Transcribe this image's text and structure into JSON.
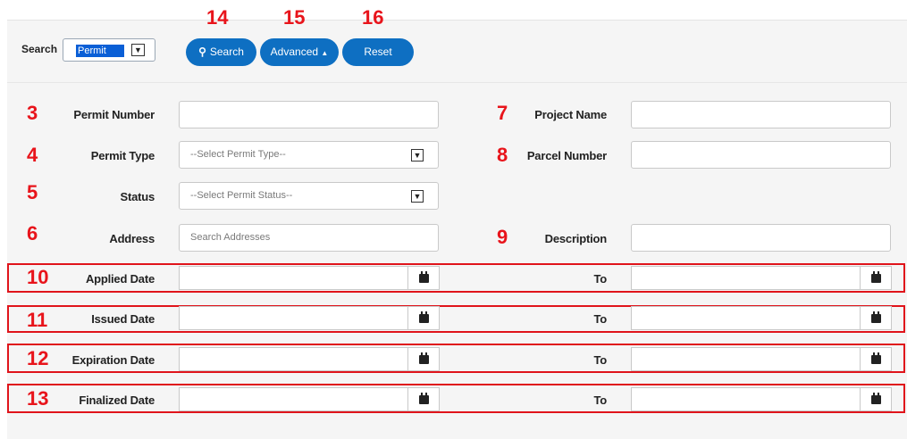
{
  "annotations": {
    "search_btn": "14",
    "advanced_btn": "15",
    "reset_btn": "16",
    "permit_number": "3",
    "permit_type": "4",
    "status": "5",
    "address": "6",
    "project_name": "7",
    "parcel_number": "8",
    "description": "9",
    "applied_date": "10",
    "issued_date": "11",
    "expiration_date": "12",
    "finalized_date": "13"
  },
  "toolbar": {
    "search_label": "Search",
    "search_type_value": "Permit",
    "search_button": "Search",
    "advanced_button": "Advanced",
    "reset_button": "Reset"
  },
  "fields": {
    "permit_number_label": "Permit Number",
    "permit_type_label": "Permit Type",
    "permit_type_placeholder": "--Select Permit Type--",
    "status_label": "Status",
    "status_placeholder": "--Select Permit Status--",
    "address_label": "Address",
    "address_placeholder": "Search Addresses",
    "project_name_label": "Project Name",
    "parcel_number_label": "Parcel Number",
    "description_label": "Description"
  },
  "dates": {
    "applied_label": "Applied Date",
    "issued_label": "Issued Date",
    "expiration_label": "Expiration Date",
    "finalized_label": "Finalized Date",
    "to_label": "To"
  },
  "colors": {
    "button": "#0e6fc2",
    "annotation": "#e8141b",
    "panel": "#f5f5f5"
  }
}
